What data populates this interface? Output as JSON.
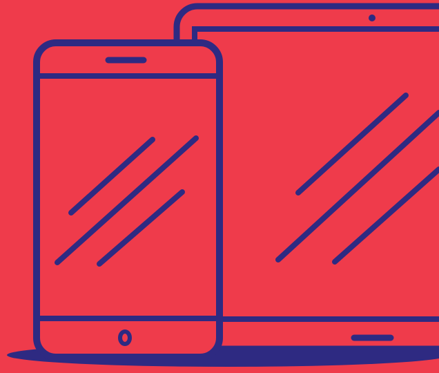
{
  "colors": {
    "background": "#ef3b4b",
    "outline": "#2e2a82"
  },
  "icons": {
    "scene": "devices-illustration-icon",
    "tablet": "tablet-icon",
    "phone": "smartphone-icon"
  }
}
